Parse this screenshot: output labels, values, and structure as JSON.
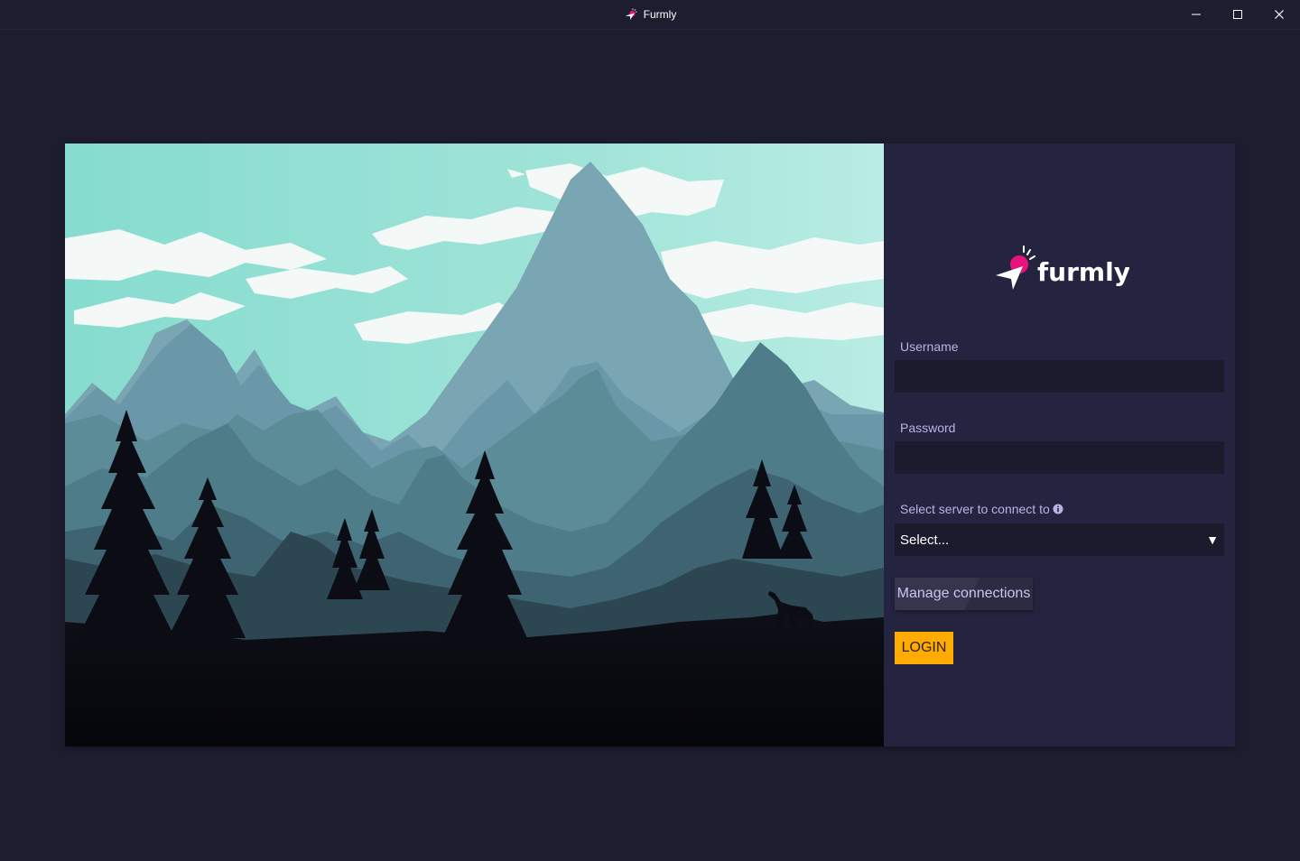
{
  "window": {
    "title": "Furmly",
    "controls": [
      "minimize-icon",
      "maximize-icon",
      "close-icon"
    ]
  },
  "brand": {
    "logo_text": "furmly",
    "accent_color": "#e8127c"
  },
  "form": {
    "username_label": "Username",
    "username_value": "",
    "password_label": "Password",
    "password_value": "",
    "server_label": "Select server to connect to",
    "server_selected": "Select...",
    "manage_label": "Manage connections",
    "login_label": "LOGIN"
  },
  "colors": {
    "background": "#1e1d30",
    "panel": "#252440",
    "input": "#1c1b2e",
    "label": "#b7b3e6",
    "login_button": "#ffab00"
  }
}
